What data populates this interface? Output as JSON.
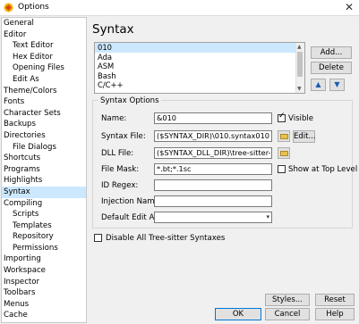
{
  "window": {
    "title": "Options",
    "close_glyph": "✕"
  },
  "tree": {
    "items": [
      {
        "label": "General",
        "level": 1
      },
      {
        "label": "Editor",
        "level": 1
      },
      {
        "label": "Text Editor",
        "level": 2
      },
      {
        "label": "Hex Editor",
        "level": 2
      },
      {
        "label": "Opening Files",
        "level": 2
      },
      {
        "label": "Edit As",
        "level": 2
      },
      {
        "label": "Theme/Colors",
        "level": 1
      },
      {
        "label": "Fonts",
        "level": 1
      },
      {
        "label": "Character Sets",
        "level": 1
      },
      {
        "label": "Backups",
        "level": 1
      },
      {
        "label": "Directories",
        "level": 1
      },
      {
        "label": "File Dialogs",
        "level": 2
      },
      {
        "label": "Shortcuts",
        "level": 1
      },
      {
        "label": "Programs",
        "level": 1
      },
      {
        "label": "Highlights",
        "level": 1
      },
      {
        "label": "Syntax",
        "level": 1,
        "selected": true
      },
      {
        "label": "Compiling",
        "level": 1
      },
      {
        "label": "Scripts",
        "level": 2
      },
      {
        "label": "Templates",
        "level": 2
      },
      {
        "label": "Repository",
        "level": 2
      },
      {
        "label": "Permissions",
        "level": 2
      },
      {
        "label": "Importing",
        "level": 1
      },
      {
        "label": "Workspace",
        "level": 1
      },
      {
        "label": "Inspector",
        "level": 1
      },
      {
        "label": "Toolbars",
        "level": 1
      },
      {
        "label": "Menus",
        "level": 1
      },
      {
        "label": "Cache",
        "level": 1
      }
    ]
  },
  "page": {
    "heading": "Syntax"
  },
  "languages": {
    "items": [
      {
        "label": "010",
        "selected": true
      },
      {
        "label": "Ada"
      },
      {
        "label": "ASM"
      },
      {
        "label": "Bash"
      },
      {
        "label": "C/C++"
      }
    ]
  },
  "side_buttons": {
    "add": "Add...",
    "delete": "Delete",
    "up_glyph": "▲",
    "down_glyph": "▼"
  },
  "group": {
    "title": "Syntax Options",
    "name_label": "Name:",
    "name_value": "&010",
    "visible_label": "Visible",
    "syntax_file_label": "Syntax File:",
    "syntax_file_value": "($SYNTAX_DIR)\\010.syntax010",
    "edit_button": "Edit...",
    "dll_file_label": "DLL File:",
    "dll_file_value": "($SYNTAX_DLL_DIR)\\tree-sitter-010.dll",
    "file_mask_label": "File Mask:",
    "file_mask_value": "*.bt;*.1sc",
    "show_top_label": "Show at Top Level",
    "id_regex_label": "ID Regex:",
    "injection_label": "Injection Name:",
    "default_edit_label": "Default Edit As:",
    "check_glyph": "✓",
    "dropdown_glyph": "▾"
  },
  "disable_all_label": "Disable All Tree-sitter Syntaxes",
  "bottom_buttons": {
    "styles": "Styles...",
    "reset": "Reset",
    "ok": "OK",
    "cancel": "Cancel",
    "help": "Help"
  }
}
